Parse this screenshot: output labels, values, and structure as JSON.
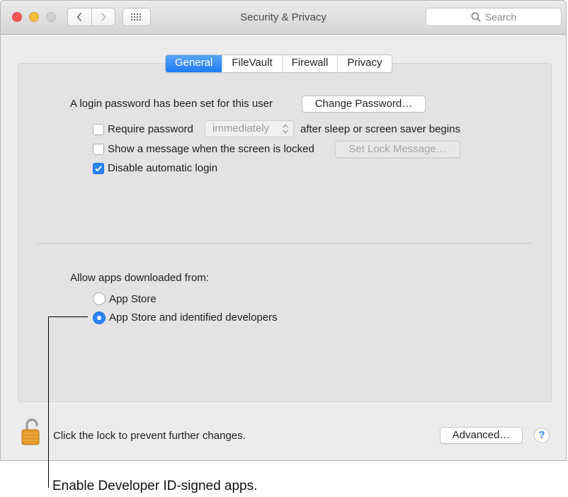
{
  "window": {
    "title": "Security & Privacy",
    "search_placeholder": "Search"
  },
  "tabs": [
    {
      "label": "General",
      "active": true
    },
    {
      "label": "FileVault",
      "active": false
    },
    {
      "label": "Firewall",
      "active": false
    },
    {
      "label": "Privacy",
      "active": false
    }
  ],
  "general": {
    "login_text": "A login password has been set for this user",
    "change_password_label": "Change Password…",
    "require_password": {
      "label": "Require password",
      "checked": false,
      "popup_value": "immediately",
      "suffix": "after sleep or screen saver begins"
    },
    "show_message": {
      "label": "Show a message when the screen is locked",
      "checked": false,
      "button_label": "Set Lock Message…"
    },
    "disable_auto_login": {
      "label": "Disable automatic login",
      "checked": true
    }
  },
  "allow_apps": {
    "heading": "Allow apps downloaded from:",
    "options": [
      {
        "label": "App Store",
        "selected": false
      },
      {
        "label": "App Store and identified developers",
        "selected": true
      }
    ]
  },
  "footer": {
    "lock_text": "Click the lock to prevent further changes.",
    "advanced_label": "Advanced…",
    "help_label": "?"
  },
  "callout": {
    "caption": "Enable Developer ID-signed apps."
  },
  "colors": {
    "accent": "#2b84f6",
    "close": "#fc5753",
    "minimize": "#fdbc40"
  }
}
